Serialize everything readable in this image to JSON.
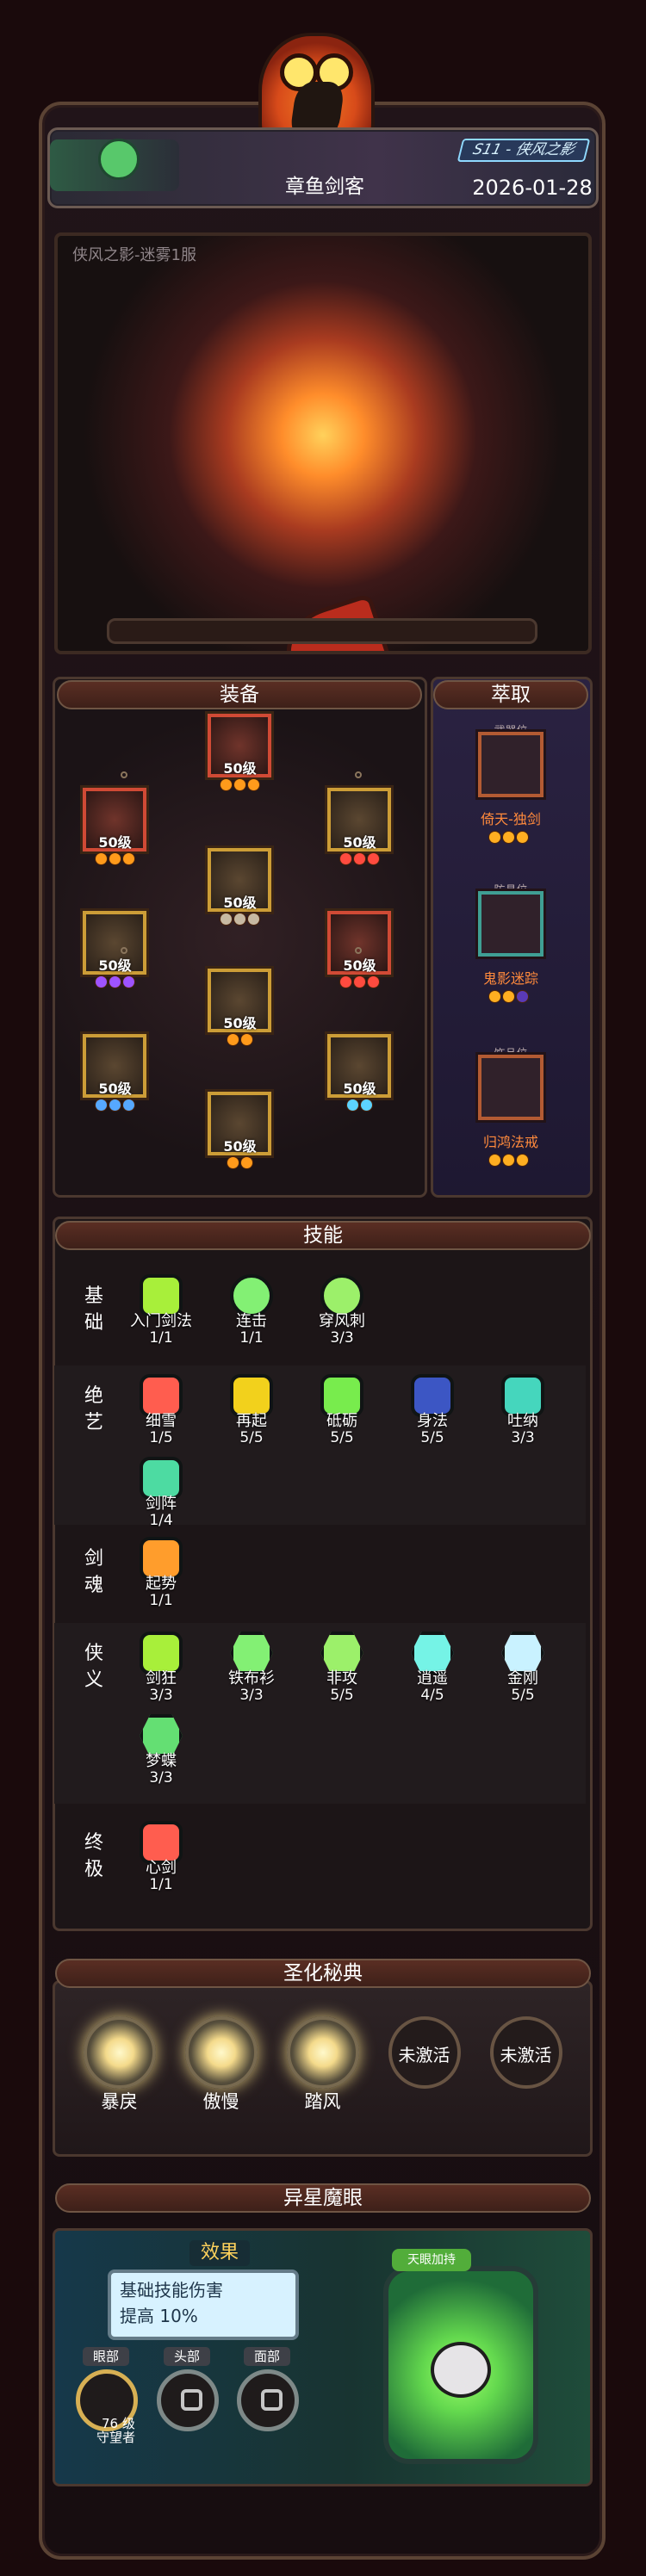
{
  "header": {
    "hero_name": "章鱼剑客",
    "season_label": "S11 - 侠风之影",
    "date": "2026-01-28",
    "server": "侠风之影-迷雾1服"
  },
  "sections": {
    "equipment": "装备",
    "extract": "萃取",
    "skills": "技能",
    "codex": "圣化秘典",
    "eye": "异星魔眼"
  },
  "equipment": {
    "level_text": "50级",
    "items": [
      {
        "id": "helm",
        "name": "helm-icon",
        "level": "50级",
        "stars": 3,
        "color": "#ff9a1b",
        "accent": "#d04a35"
      },
      {
        "id": "left-hat",
        "name": "helmet-icon",
        "level": "50级",
        "stars": 3,
        "color": "#ff9a1b",
        "accent": "#d04a35"
      },
      {
        "id": "armor",
        "name": "armor-icon",
        "level": "50级",
        "stars": 3,
        "color": "#c7b9a2",
        "accent": "#cc9d37"
      },
      {
        "id": "right-pet",
        "name": "pet-icon",
        "level": "50级",
        "stars": 3,
        "color": "#ff4b3f",
        "accent": "#cc9d37"
      },
      {
        "id": "gloves",
        "name": "gloves-icon",
        "level": "50级",
        "stars": 3,
        "color": "#9e53ff",
        "accent": "#cc9d37"
      },
      {
        "id": "pants",
        "name": "pants-icon",
        "level": "50级",
        "stars": 2,
        "color": "#ff9a1b",
        "accent": "#cc9d37"
      },
      {
        "id": "bracelet",
        "name": "bracelet-icon",
        "level": "50级",
        "stars": 3,
        "color": "#ff4b3f",
        "accent": "#d04a35"
      },
      {
        "id": "sword",
        "name": "sword-icon",
        "level": "50级",
        "stars": 3,
        "color": "#56a8ff",
        "accent": "#cc9d37"
      },
      {
        "id": "ring",
        "name": "ring-icon",
        "level": "50级",
        "stars": 2,
        "color": "#5cd3ff",
        "accent": "#cc9d37"
      },
      {
        "id": "boots",
        "name": "boots-icon",
        "level": "50级",
        "stars": 2,
        "color": "#ff9a1b",
        "accent": "#cc9d37"
      }
    ]
  },
  "extract": {
    "items": [
      {
        "slot": "武器位",
        "name": "倚天-独剑",
        "stars": 3
      },
      {
        "slot": "防具位",
        "name": "鬼影迷踪",
        "stars": 3
      },
      {
        "slot": "饰品位",
        "name": "归鸿法戒",
        "stars": 3
      }
    ]
  },
  "skills": {
    "rows": [
      {
        "label": "基础",
        "items": [
          {
            "name": "入门剑法",
            "level": "1/1"
          },
          {
            "name": "连击",
            "level": "1/1"
          },
          {
            "name": "穿风刺",
            "level": "3/3"
          }
        ]
      },
      {
        "label": "绝艺",
        "items": [
          {
            "name": "细雪",
            "level": "1/5"
          },
          {
            "name": "再起",
            "level": "5/5"
          },
          {
            "name": "砥砺",
            "level": "5/5"
          },
          {
            "name": "身法",
            "level": "5/5"
          },
          {
            "name": "吐纳",
            "level": "3/3"
          },
          {
            "name": "剑阵",
            "level": "1/4"
          }
        ]
      },
      {
        "label": "剑魂",
        "items": [
          {
            "name": "起势",
            "level": "1/1"
          }
        ]
      },
      {
        "label": "侠义",
        "items": [
          {
            "name": "剑狂",
            "level": "3/3"
          },
          {
            "name": "铁布衫",
            "level": "3/3"
          },
          {
            "name": "非攻",
            "level": "5/5"
          },
          {
            "name": "逍遥",
            "level": "4/5"
          },
          {
            "name": "金刚",
            "level": "5/5"
          },
          {
            "name": "梦蝶",
            "level": "3/3"
          }
        ]
      },
      {
        "label": "终极",
        "items": [
          {
            "name": "心剑",
            "level": "1/1"
          }
        ]
      }
    ]
  },
  "codex": {
    "items": [
      {
        "name": "暴戾",
        "active": true
      },
      {
        "name": "傲慢",
        "active": true
      },
      {
        "name": "踏风",
        "active": true
      },
      {
        "name": "未激活",
        "active": false
      },
      {
        "name": "未激活",
        "active": false
      }
    ]
  },
  "eye": {
    "effect": "效果",
    "effect_line_1": "基础技能伤害",
    "effect_line_2": "提高 10%",
    "sockets": [
      "眼部",
      "头部",
      "面部"
    ],
    "eye_level": "76 级",
    "eye_name": "守望者",
    "badge": "天眼加持"
  },
  "colors": {
    "accent": "#ffaf29",
    "panel": "#4b382f",
    "text": "#f1e4cf"
  }
}
